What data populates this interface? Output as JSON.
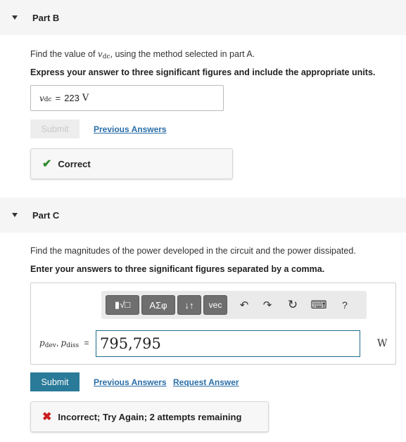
{
  "partB": {
    "title": "Part B",
    "question": "Find the value of",
    "question_var": "v",
    "question_sub": "dc",
    "question_rest": ", using the method selected in part A.",
    "instruction": "Express your answer to three significant figures and include the appropriate units.",
    "answer": {
      "var": "v",
      "sub": "dc",
      "eq": "=",
      "value": "223",
      "unit": "V"
    },
    "submit_label": "Submit",
    "previous_answers_label": "Previous Answers",
    "feedback": "Correct",
    "feedback_color": "#2e8b2e"
  },
  "partC": {
    "title": "Part C",
    "question": "Find the magnitudes of the power developed in the circuit and  the power dissipated.",
    "instruction": "Enter your answers to three significant figures separated by a comma.",
    "toolbar": {
      "templates_label": "▮√□",
      "greek_label": "ΑΣφ",
      "arrows_label": "↓↑",
      "vec_label": "vec",
      "undo_icon": "↶",
      "redo_icon": "↷",
      "reset_icon": "↻",
      "keyboard_icon": "⌨",
      "help_icon": "?"
    },
    "formula": {
      "var1": "p",
      "sub1": "dev",
      "sep": ", ",
      "var2": "p",
      "sub2": "diss",
      "eq": "="
    },
    "answer_value": "795,795",
    "unit": "W",
    "submit_label": "Submit",
    "previous_answers_label": "Previous Answers",
    "request_answer_label": "Request Answer",
    "feedback": "Incorrect; Try Again; 2 attempts remaining",
    "feedback_color": "#cc1f1f"
  }
}
